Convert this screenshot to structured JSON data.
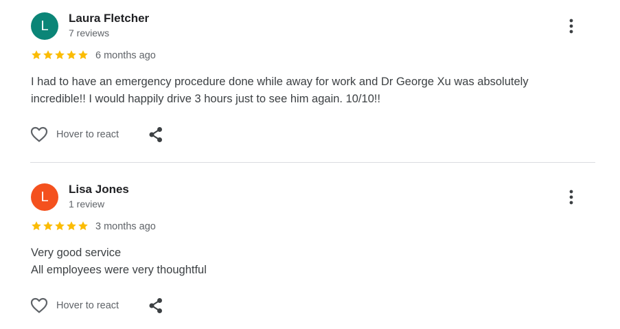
{
  "reviews": [
    {
      "avatar_letter": "L",
      "avatar_color": "#0b8577",
      "author": "Laura Fletcher",
      "review_count": "7 reviews",
      "rating": 5,
      "date": "6 months ago",
      "text_lines": [
        "I had to have an emergency procedure done while away for work and Dr George Xu was absolutely",
        "incredible!! I would happily drive 3 hours just to see him again. 10/10!!"
      ],
      "react_label": "Hover to react"
    },
    {
      "avatar_letter": "L",
      "avatar_color": "#f4511e",
      "author": "Lisa Jones",
      "review_count": "1 review",
      "rating": 5,
      "date": "3 months ago",
      "text_lines": [
        "Very good service",
        "All employees were very thoughtful"
      ],
      "react_label": "Hover to react"
    }
  ],
  "colors": {
    "star": "#fbbc04",
    "icon": "#5f6368",
    "divider": "#dadce0"
  },
  "icons": {
    "more": "more-vert-icon",
    "react": "heart-outline-icon",
    "share": "share-icon",
    "star": "star-icon"
  }
}
